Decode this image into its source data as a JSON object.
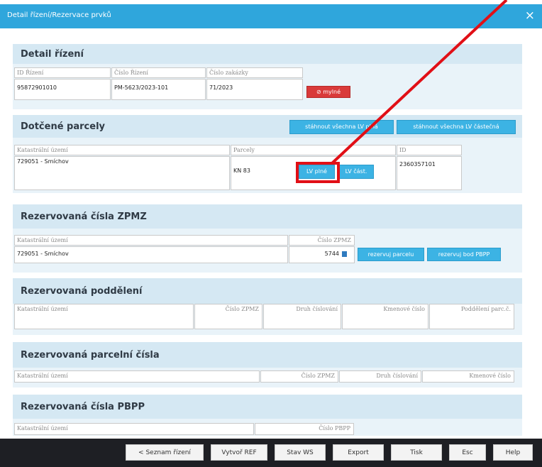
{
  "dialog": {
    "title": "Detail řízení/Rezervace prvků",
    "close_label": "×"
  },
  "detail": {
    "heading": "Detail řízení",
    "headers": [
      "ID Řízení",
      "Číslo Řízení",
      "Číslo zakázky"
    ],
    "values": [
      "95872901010",
      "PM-5623/2023-101",
      "71/2023"
    ],
    "status_badge": "mylné"
  },
  "parcels": {
    "heading": "Dotčené parcely",
    "btn_all_lv": "stáhnout všechna LV plná",
    "btn_all_partial": "stáhnout všechna LV částečná",
    "headers": [
      "Katastrální území",
      "Parcely",
      "ID"
    ],
    "row": {
      "territory": "729051 - Smíchov",
      "parcel": "KN 83",
      "btn_full": "LV plné",
      "btn_partial": "LV část.",
      "id": "2360357101"
    }
  },
  "zpmz": {
    "heading": "Rezervovaná čísla ZPMZ",
    "headers": [
      "Katastrální území",
      "Číslo ZPMZ"
    ],
    "row": {
      "territory": "729051 - Smíchov",
      "number": "5744"
    },
    "btn_reserve_parcel": "rezervuj parcelu",
    "btn_reserve_pbpp": "rezervuj bod PBPP"
  },
  "subdivisions": {
    "heading": "Rezervovaná poddělení",
    "headers": [
      "Katastrální území",
      "Číslo ZPMZ",
      "Druh číslování",
      "Kmenové číslo",
      "Poddělení parc.č."
    ]
  },
  "parcel_numbers": {
    "heading": "Rezervovaná parcelní čísla",
    "headers": [
      "Katastrální území",
      "Číslo ZPMZ",
      "Druh číslování",
      "Kmenové číslo"
    ]
  },
  "pbpp": {
    "heading": "Rezervovaná čísla PBPP",
    "headers": [
      "Katastrální území",
      "Číslo PBPP"
    ]
  },
  "footer": {
    "buttons": [
      "< Seznam řízení",
      "Vytvoř REF",
      "Stav WS",
      "Export",
      "Tisk",
      "Esc",
      "Help"
    ]
  },
  "colors": {
    "accent": "#2fa6dc",
    "button_blue": "#3cb3e4",
    "status_red": "#d93a3a",
    "highlight_red": "#e10f16"
  }
}
